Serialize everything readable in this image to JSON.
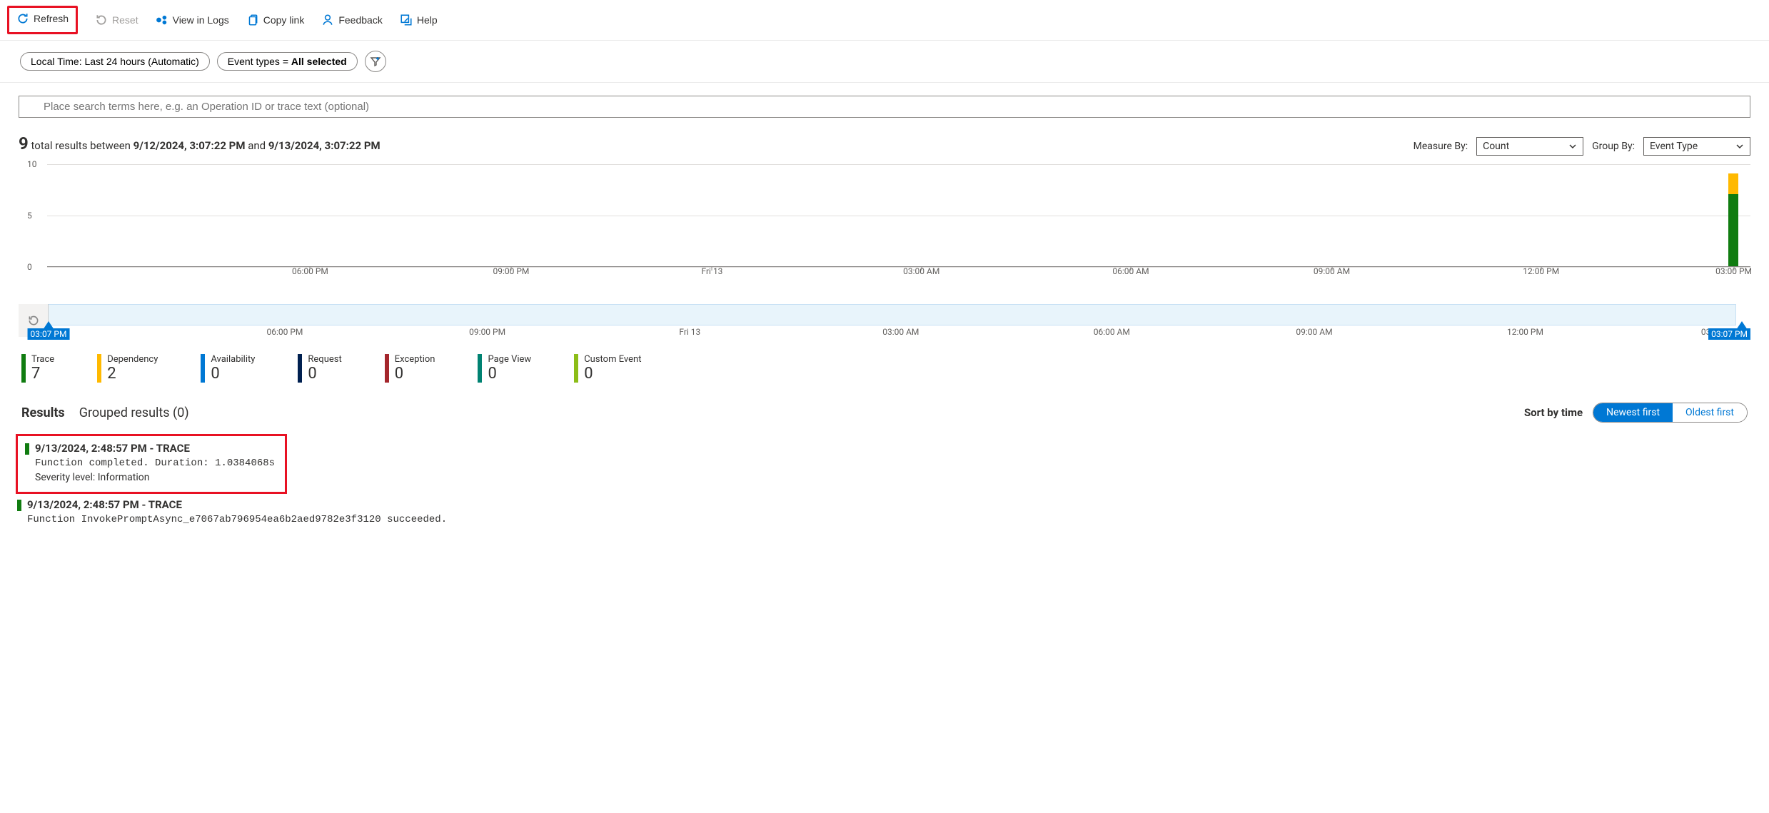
{
  "toolbar": {
    "refresh": "Refresh",
    "reset": "Reset",
    "view_logs": "View in Logs",
    "copy_link": "Copy link",
    "feedback": "Feedback",
    "help": "Help"
  },
  "filters": {
    "time_pill": "Local Time: Last 24 hours (Automatic)",
    "event_pill_prefix": "Event types = ",
    "event_pill_value": "All selected"
  },
  "search": {
    "placeholder": "Place search terms here, e.g. an Operation ID or trace text (optional)"
  },
  "summary": {
    "total": "9",
    "text1": " total results between ",
    "from": "9/12/2024, 3:07:22 PM",
    "text2": " and ",
    "to": "9/13/2024, 3:07:22 PM",
    "measure_by_label": "Measure By:",
    "measure_by_value": "Count",
    "group_by_label": "Group By:",
    "group_by_value": "Event Type"
  },
  "chart_data": {
    "type": "bar",
    "ylim": [
      0,
      10
    ],
    "y_ticks": [
      0,
      5,
      10
    ],
    "x_ticks": [
      "06:00 PM",
      "09:00 PM",
      "Fri 13",
      "03:00 AM",
      "06:00 AM",
      "09:00 AM",
      "12:00 PM",
      "03:00 PM"
    ],
    "x_positions_pct": [
      14,
      26,
      38,
      50.5,
      63,
      75,
      87.5,
      99
    ],
    "stacks": [
      {
        "x_pct": 99,
        "segments": [
          {
            "series": "Trace",
            "value": 7,
            "color": "#107c10"
          },
          {
            "series": "Dependency",
            "value": 2,
            "color": "#ffb900"
          }
        ]
      }
    ]
  },
  "brush": {
    "start_label": "03:07 PM",
    "end_label": "03:07 PM",
    "ticks": [
      "06:00 PM",
      "09:00 PM",
      "Fri 13",
      "03:00 AM",
      "06:00 AM",
      "09:00 AM",
      "12:00 PM",
      "03:00 PM"
    ],
    "tick_pos_pct": [
      14,
      26,
      38,
      50.5,
      63,
      75,
      87.5,
      99
    ]
  },
  "legend": [
    {
      "label": "Trace",
      "value": "7",
      "color": "#107c10"
    },
    {
      "label": "Dependency",
      "value": "2",
      "color": "#ffb900"
    },
    {
      "label": "Availability",
      "value": "0",
      "color": "#0078d4"
    },
    {
      "label": "Request",
      "value": "0",
      "color": "#002050"
    },
    {
      "label": "Exception",
      "value": "0",
      "color": "#a4262c"
    },
    {
      "label": "Page View",
      "value": "0",
      "color": "#008272"
    },
    {
      "label": "Custom Event",
      "value": "0",
      "color": "#8cbd18"
    }
  ],
  "tabs": {
    "results": "Results",
    "grouped": "Grouped results (0)",
    "sort_label": "Sort by time",
    "newest": "Newest first",
    "oldest": "Oldest first"
  },
  "results": [
    {
      "head": "9/13/2024, 2:48:57 PM - TRACE",
      "msg": "Function completed. Duration: 1.0384068s",
      "sev": "Severity level: Information"
    },
    {
      "head": "9/13/2024, 2:48:57 PM - TRACE",
      "msg": "Function InvokePromptAsync_e7067ab796954ea6b2aed9782e3f3120 succeeded."
    }
  ]
}
